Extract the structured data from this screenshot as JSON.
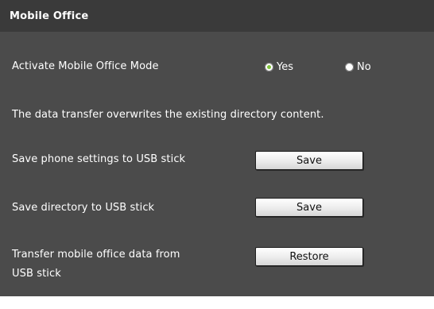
{
  "header": {
    "title": "Mobile Office"
  },
  "activate_mode": {
    "label": "Activate Mobile Office Mode",
    "options": [
      {
        "label": "Yes",
        "selected": true
      },
      {
        "label": "No",
        "selected": false
      }
    ]
  },
  "notice": "The data transfer overwrites the existing directory content.",
  "actions": {
    "save_settings": {
      "label": "Save phone settings to USB stick",
      "button": "Save"
    },
    "save_directory": {
      "label": "Save directory to USB stick",
      "button": "Save"
    },
    "restore": {
      "label_line1": "Transfer mobile office data from",
      "label_line2": "USB stick",
      "button": "Restore"
    }
  },
  "colors": {
    "panel_bg": "#4b4b4b",
    "header_bg": "#3a3a3a",
    "text": "#ffffff",
    "radio_selected": "#7ec23a"
  }
}
